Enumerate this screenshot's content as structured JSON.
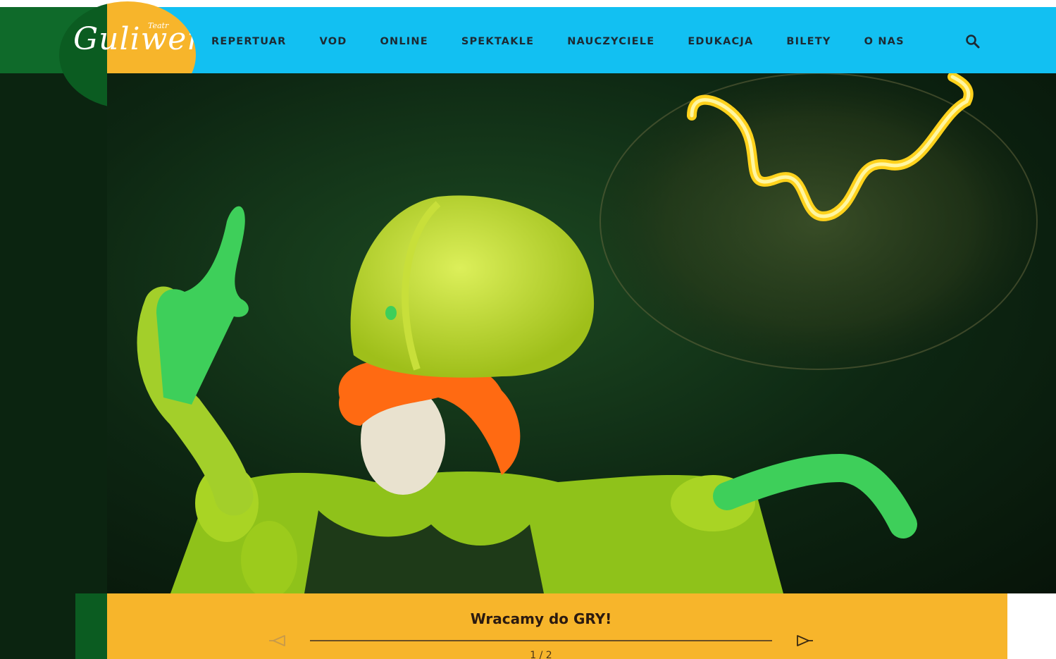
{
  "logo": {
    "brand": "Guliwer",
    "sub": "Teatr"
  },
  "nav": {
    "items": [
      {
        "label": "REPERTUAR"
      },
      {
        "label": "VOD"
      },
      {
        "label": "ONLINE"
      },
      {
        "label": "SPEKTAKLE"
      },
      {
        "label": "NAUCZYCIELE"
      },
      {
        "label": "EDUKACJA"
      },
      {
        "label": "BILETY"
      },
      {
        "label": "O NAS"
      }
    ],
    "search_icon": "search-icon"
  },
  "slider": {
    "title": "Wracamy do GRY!",
    "counter": "1 / 2",
    "prev_icon": "arrow-left-icon",
    "next_icon": "arrow-right-icon"
  },
  "colors": {
    "header": "#12c0f2",
    "caption": "#f7b52b",
    "dark_green": "#0b5c21"
  }
}
